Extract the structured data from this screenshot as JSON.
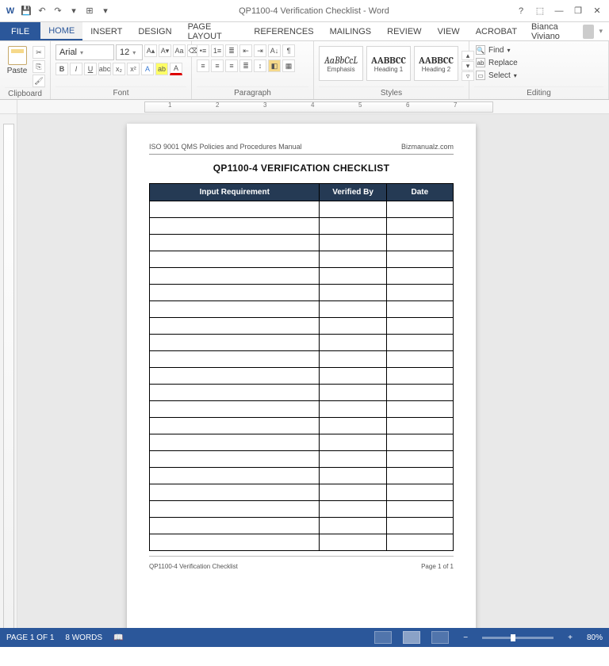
{
  "app": {
    "title": "QP1100-4 Verification Checklist - Word"
  },
  "user": {
    "name": "Bianca Viviano"
  },
  "qat": {
    "save": "save",
    "undo": "undo",
    "redo": "redo",
    "touch": "touch"
  },
  "tabs": {
    "file": "FILE",
    "home": "HOME",
    "insert": "INSERT",
    "design": "DESIGN",
    "page_layout": "PAGE LAYOUT",
    "references": "REFERENCES",
    "mailings": "MAILINGS",
    "review": "REVIEW",
    "view": "VIEW",
    "acrobat": "ACROBAT"
  },
  "ribbon": {
    "clipboard": {
      "paste": "Paste",
      "label": "Clipboard"
    },
    "font": {
      "name": "Arial",
      "size": "12",
      "label": "Font"
    },
    "paragraph": {
      "label": "Paragraph"
    },
    "styles": {
      "label": "Styles",
      "items": [
        {
          "sample": "AaBbCcL",
          "name": "Emphasis"
        },
        {
          "sample": "AABBCC",
          "name": "Heading 1"
        },
        {
          "sample": "AABBCC",
          "name": "Heading 2"
        }
      ]
    },
    "editing": {
      "find": "Find",
      "replace": "Replace",
      "select": "Select",
      "label": "Editing"
    }
  },
  "ruler": {
    "marks": [
      "1",
      "2",
      "3",
      "4",
      "5",
      "6",
      "7"
    ]
  },
  "document": {
    "header_left": "ISO 9001 QMS Policies and Procedures Manual",
    "header_right": "Bizmanualz.com",
    "title": "QP1100-4 VERIFICATION CHECKLIST",
    "columns": [
      "Input Requirement",
      "Verified By",
      "Date"
    ],
    "rows": 21,
    "footer_left": "QP1100-4 Verification Checklist",
    "footer_right": "Page 1 of 1"
  },
  "status": {
    "page": "PAGE 1 OF 1",
    "words": "8 WORDS",
    "zoom_pct": "80%"
  }
}
